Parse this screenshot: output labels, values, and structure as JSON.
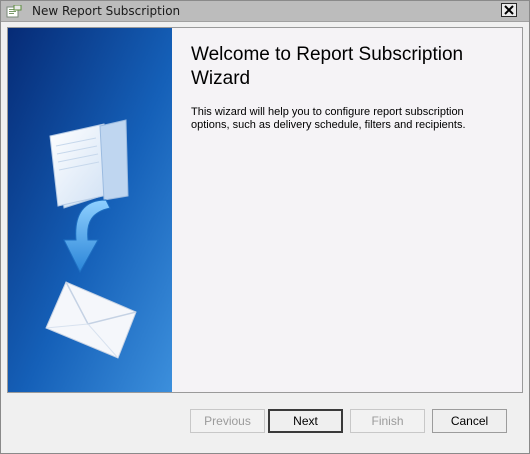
{
  "window": {
    "title": "New Report Subscription"
  },
  "wizard": {
    "title": "Welcome to Report Subscription Wizard",
    "description": "This wizard will help you to configure report subscription options, such as delivery schedule, filters and recipients."
  },
  "buttons": {
    "previous": "Previous",
    "next": "Next",
    "finish": "Finish",
    "cancel": "Cancel"
  }
}
